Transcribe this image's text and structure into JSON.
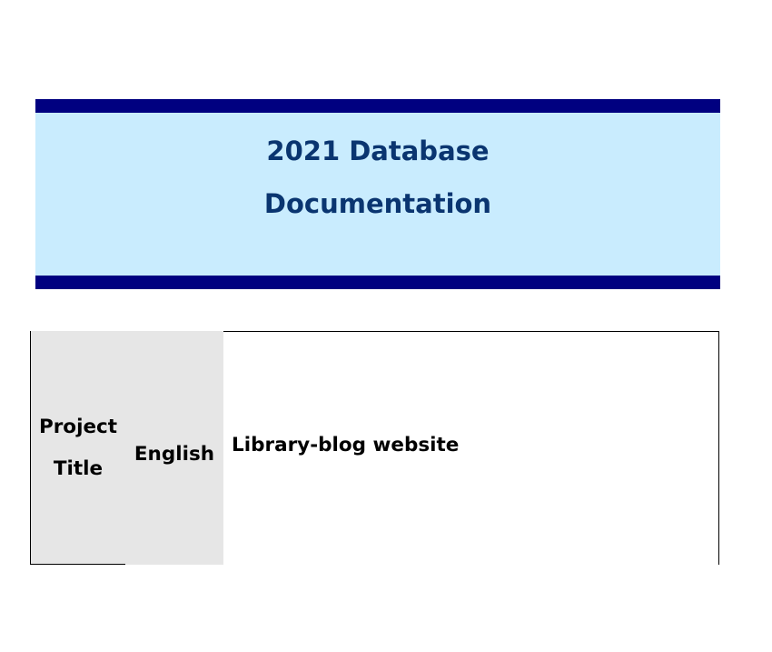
{
  "banner": {
    "title_line1": "2021 Database",
    "title_line2": "Documentation",
    "colors": {
      "bar": "#000080",
      "background": "#c9ecfe",
      "title_text": "#0a3570"
    }
  },
  "project_table": {
    "label": "Project Title",
    "language": "English",
    "value": "Library-blog website",
    "colors": {
      "header_cell": "#e6e6e6",
      "border": "#000000"
    }
  }
}
